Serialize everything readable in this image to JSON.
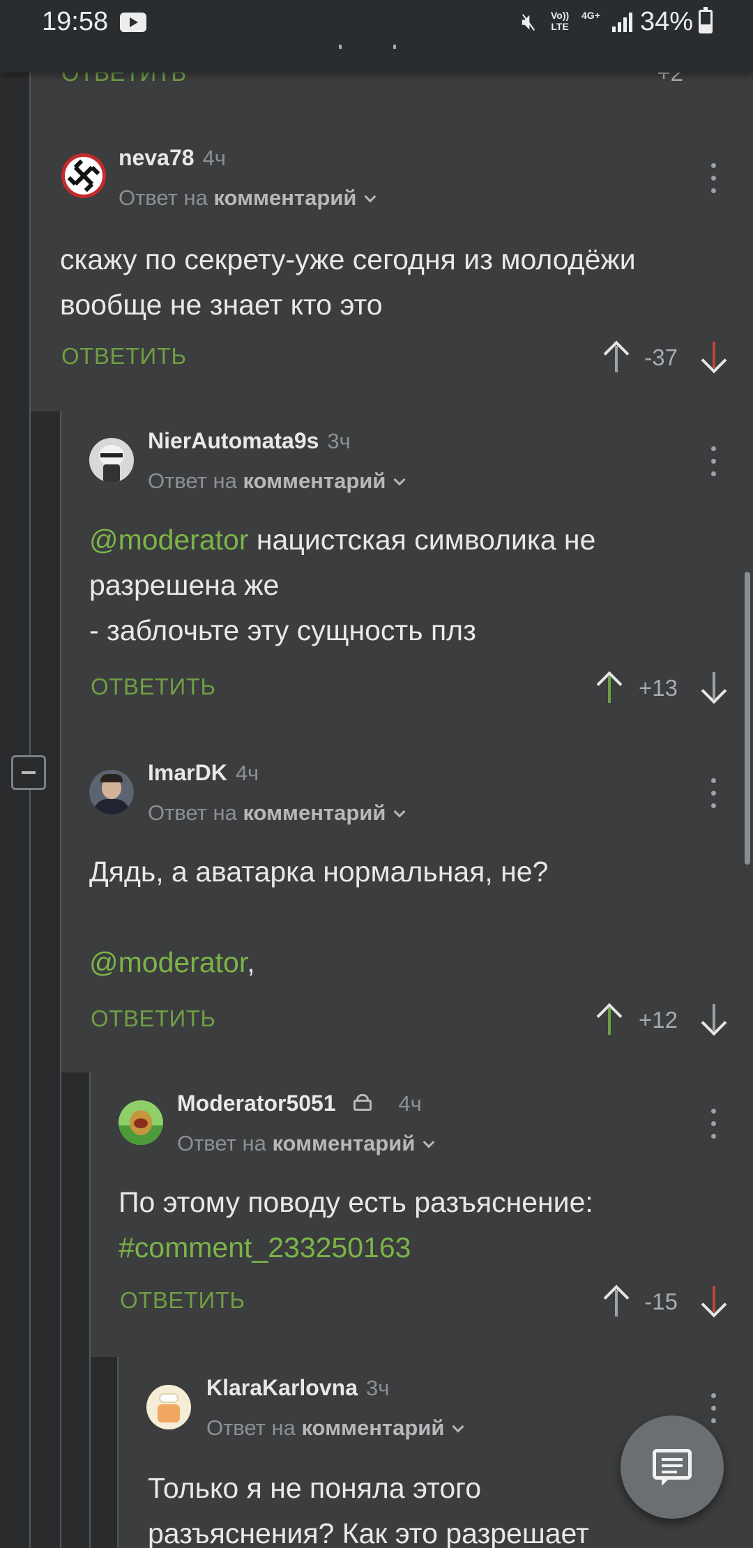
{
  "status_bar": {
    "time": "19:58",
    "volte": "Vo)) LTE",
    "network": "4G+",
    "battery": "34%"
  },
  "top_partial": {
    "reply_label": "ОТВЕТИТЬ",
    "score": "+2"
  },
  "comments": [
    {
      "author": "neva78",
      "time": "4ч",
      "reply_prefix": "Ответ на",
      "reply_target": "комментарий",
      "text": [
        "скажу по секрету-уже сегодня из молодёжи",
        "вообще не знает кто это"
      ],
      "reply_label": "ОТВЕТИТЬ",
      "score": "-37"
    },
    {
      "author": "NierAutomata9s",
      "time": "3ч",
      "reply_prefix": "Ответ на",
      "reply_target": "комментарий",
      "mention": "@moderator",
      "text": [
        " нацистская символика не",
        "разрешена же",
        "- заблочьте эту сущность плз"
      ],
      "reply_label": "ОТВЕТИТЬ",
      "score": "+13"
    },
    {
      "author": "ImarDK",
      "time": "4ч",
      "reply_prefix": "Ответ на",
      "reply_target": "комментарий",
      "text": [
        "Дядь, а аватарка нормальная, не?"
      ],
      "mention": "@moderator",
      "mention_suffix": ",",
      "reply_label": "ОТВЕТИТЬ",
      "score": "+12"
    },
    {
      "author": "Moderator5051",
      "time": "4ч",
      "reply_prefix": "Ответ на",
      "reply_target": "комментарий",
      "text": [
        "По этому поводу есть разъяснение:"
      ],
      "link": "#comment_233250163",
      "reply_label": "ОТВЕТИТЬ",
      "score": "-15"
    },
    {
      "author": "KlaraKarlovna",
      "time": "3ч",
      "reply_prefix": "Ответ на",
      "reply_target": "комментарий",
      "text": [
        "Только я не поняла этого",
        "разъяснения? Как это разрешает"
      ]
    }
  ],
  "colors": {
    "accent_green": "#6f9e45",
    "mention_green": "#7bb449",
    "downvote_red": "#c0463a",
    "background": "#3c3d3e"
  },
  "icons": {
    "fab": "comment-icon",
    "collapse": "collapse-minus-icon"
  }
}
